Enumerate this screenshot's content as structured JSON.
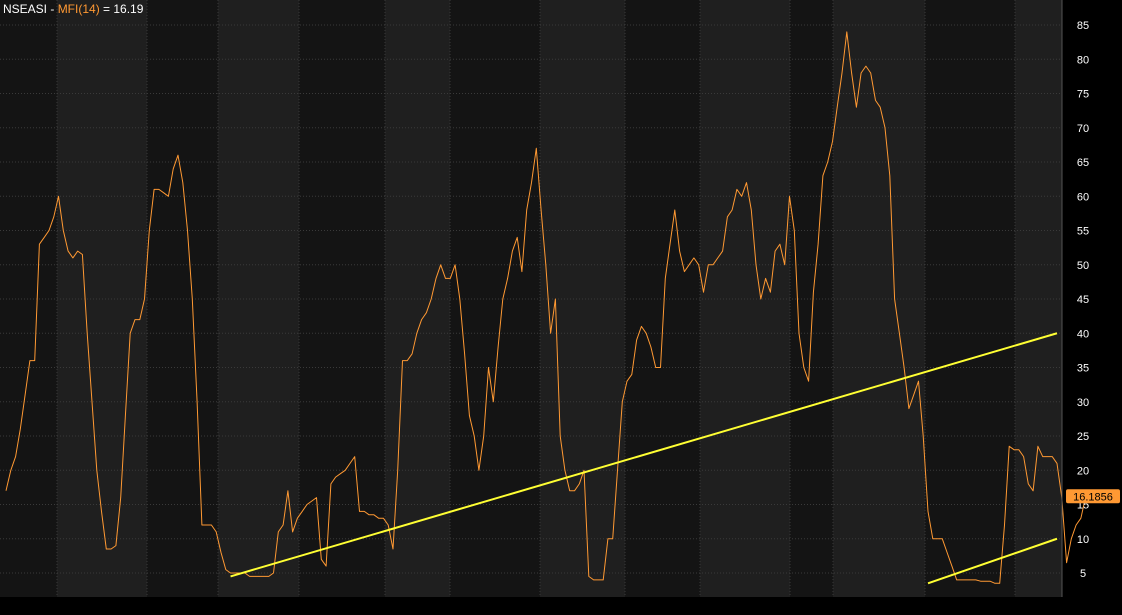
{
  "legend": {
    "symbol": "NSEASI",
    "sep": " - ",
    "indicator": "MFI(14)",
    "equals": " = ",
    "value": "16.19"
  },
  "last_value_label": "16.1856",
  "colors": {
    "background": "#000000",
    "band_dark": "#141414",
    "band_light": "#1f1f1f",
    "grid": "#3a3a3a",
    "line": "#ff9933",
    "trendline": "#ffff33",
    "axis_text": "#ffffff",
    "value_tag": "#ff9933"
  },
  "chart_data": {
    "type": "line",
    "title": "",
    "series": [
      {
        "name": "MFI(14)",
        "values": [
          17,
          20,
          22,
          26,
          31,
          36,
          36,
          53,
          54,
          55,
          57,
          60,
          55,
          52,
          51,
          52,
          51.5,
          40,
          30,
          20,
          14,
          8.5,
          8.5,
          9,
          16,
          28,
          40,
          42,
          42,
          45,
          55,
          61,
          61,
          60.5,
          60,
          64,
          66,
          62,
          55,
          45,
          30,
          12,
          12,
          12,
          11,
          8,
          5.5,
          5,
          5,
          5,
          5,
          4.5,
          4.5,
          4.5,
          4.5,
          4.5,
          5,
          11,
          12,
          17,
          11,
          13,
          14,
          15,
          15.5,
          16,
          7,
          6,
          18,
          19,
          19.5,
          20,
          21,
          22,
          14,
          14,
          13.5,
          13.5,
          13,
          13,
          12,
          8.5,
          20,
          36,
          36,
          37,
          40,
          42,
          43,
          45,
          48,
          50,
          48,
          48,
          50,
          45,
          37,
          28,
          25,
          20,
          25,
          35,
          30,
          38,
          45,
          48,
          52,
          54,
          49,
          58,
          62,
          67,
          58,
          50,
          40,
          45,
          25,
          20,
          17,
          17,
          18,
          20,
          4.5,
          4,
          4,
          4,
          10,
          10,
          20,
          30,
          33,
          34,
          39,
          41,
          40,
          38,
          35,
          35,
          48,
          53,
          58,
          52,
          49,
          50,
          51,
          50,
          46,
          50,
          50,
          51,
          52,
          57,
          58,
          61,
          60,
          62,
          58,
          50,
          45,
          48,
          46,
          52,
          53,
          50,
          60,
          55,
          40,
          35,
          33,
          46,
          53,
          63,
          65,
          68,
          73,
          78,
          84,
          78,
          73,
          78,
          79,
          78,
          74,
          73,
          70,
          63,
          45,
          40,
          35,
          29,
          31,
          33,
          25,
          14,
          10,
          10,
          10,
          8,
          6,
          4,
          4,
          4,
          4,
          4,
          3.8,
          3.8,
          3.8,
          3.5,
          3.5,
          12,
          23.5,
          23,
          23,
          22,
          18,
          17,
          23.5,
          22,
          22,
          22,
          21,
          16,
          6.5,
          10,
          12,
          13,
          16.2
        ]
      }
    ],
    "trendlines": [
      {
        "x": [
          47,
          220
        ],
        "y": [
          4.5,
          40
        ]
      },
      {
        "x": [
          193,
          220
        ],
        "y": [
          3.5,
          10
        ]
      }
    ],
    "x_count": 221,
    "yticks": [
      5,
      10,
      15,
      20,
      25,
      30,
      35,
      40,
      45,
      50,
      55,
      60,
      65,
      70,
      75,
      80,
      85
    ],
    "ylim": [
      0,
      87
    ],
    "grid": true,
    "axis_position": "right"
  }
}
